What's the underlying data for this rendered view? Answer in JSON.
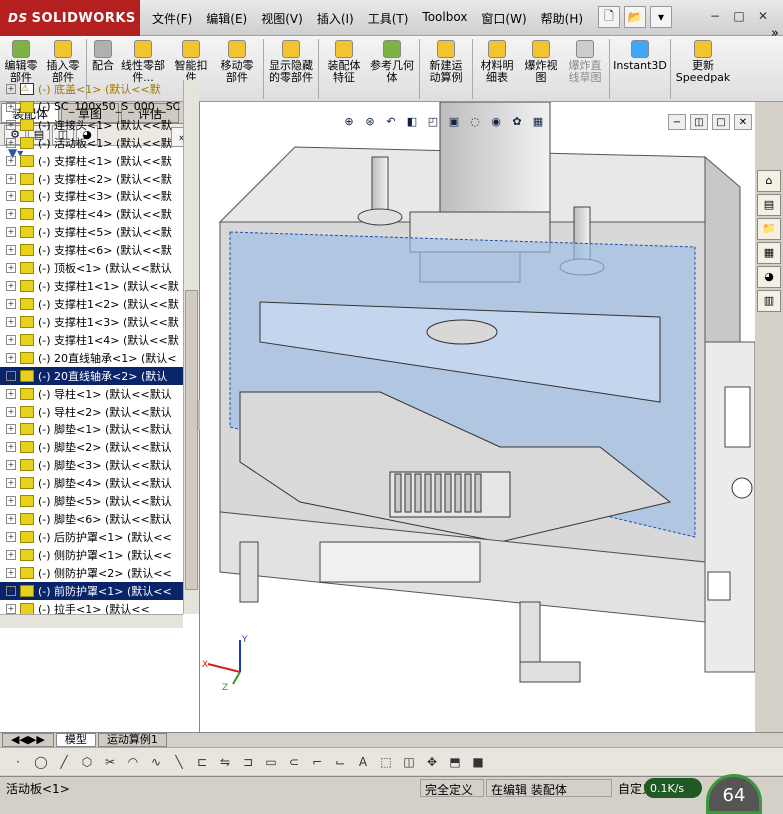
{
  "app": {
    "brand": "SOLIDWORKS",
    "brand_prefix": "DS"
  },
  "menu": [
    "文件(F)",
    "编辑(E)",
    "视图(V)",
    "插入(I)",
    "工具(T)",
    "Toolbox",
    "窗口(W)",
    "帮助(H)"
  ],
  "quick_tools": [
    "new-file-icon",
    "open-icon",
    "dropdown-icon"
  ],
  "window_controls": [
    "−",
    "□",
    "✕"
  ],
  "commands": [
    {
      "label": "编辑零部件",
      "icon": "edit-component-icon",
      "color": "#7cb342"
    },
    {
      "label": "插入零部件",
      "icon": "insert-component-icon",
      "color": "#f4c430"
    },
    {
      "label": "配合",
      "icon": "mate-icon",
      "color": "#b0b0b0"
    },
    {
      "label": "线性零部件...",
      "icon": "linear-pattern-icon",
      "color": "#f4c430"
    },
    {
      "label": "智能扣件",
      "icon": "smart-fastener-icon",
      "color": "#f4c430"
    },
    {
      "label": "移动零部件",
      "icon": "move-component-icon",
      "color": "#f4c430"
    },
    {
      "label": "显示隐藏的零部件",
      "icon": "show-hidden-icon",
      "color": "#f4c430"
    },
    {
      "label": "装配体特征",
      "icon": "assembly-feature-icon",
      "color": "#f4c430"
    },
    {
      "label": "参考几何体",
      "icon": "reference-geometry-icon",
      "color": "#7cb342"
    },
    {
      "label": "新建运动算例",
      "icon": "new-motion-study-icon",
      "color": "#f4c430"
    },
    {
      "label": "材料明细表",
      "icon": "bom-icon",
      "color": "#f4c430"
    },
    {
      "label": "爆炸视图",
      "icon": "exploded-view-icon",
      "color": "#f4c430"
    },
    {
      "label": "爆炸直线草图",
      "icon": "explode-line-sketch-icon",
      "color": "#cccccc",
      "disabled": true
    },
    {
      "label": "Instant3D",
      "icon": "instant3d-icon",
      "color": "#3fa9f5"
    },
    {
      "label": "更新Speedpak",
      "icon": "speedpak-icon",
      "color": "#f4c430"
    }
  ],
  "panel_tabs": [
    "装配体",
    "草图",
    "评估"
  ],
  "tree": [
    {
      "label": "(-) 底盖<1> (默认<<默",
      "warn": true
    },
    {
      "label": "(-) SC_100x50_S_000__SC"
    },
    {
      "label": "(-) 连接头<1> (默认<<默"
    },
    {
      "label": "(-) 活动板<1> (默认<<默"
    },
    {
      "label": "(-) 支撑柱<1> (默认<<默"
    },
    {
      "label": "(-) 支撑柱<2> (默认<<默"
    },
    {
      "label": "(-) 支撑柱<3> (默认<<默"
    },
    {
      "label": "(-) 支撑柱<4> (默认<<默"
    },
    {
      "label": "(-) 支撑柱<5> (默认<<默"
    },
    {
      "label": "(-) 支撑柱<6> (默认<<默"
    },
    {
      "label": "(-) 顶板<1> (默认<<默认"
    },
    {
      "label": "(-) 支撑柱1<1> (默认<<默"
    },
    {
      "label": "(-) 支撑柱1<2> (默认<<默"
    },
    {
      "label": "(-) 支撑柱1<3> (默认<<默"
    },
    {
      "label": "(-) 支撑柱1<4> (默认<<默"
    },
    {
      "label": "(-) 20直线轴承<1> (默认<"
    },
    {
      "label": "(-) 20直线轴承<2> (默认",
      "sel": true
    },
    {
      "label": "(-) 导柱<1> (默认<<默认"
    },
    {
      "label": "(-) 导柱<2> (默认<<默认"
    },
    {
      "label": "(-) 脚垫<1> (默认<<默认"
    },
    {
      "label": "(-) 脚垫<2> (默认<<默认"
    },
    {
      "label": "(-) 脚垫<3> (默认<<默认"
    },
    {
      "label": "(-) 脚垫<4> (默认<<默认"
    },
    {
      "label": "(-) 脚垫<5> (默认<<默认"
    },
    {
      "label": "(-) 脚垫<6> (默认<<默认"
    },
    {
      "label": "(-) 后防护罩<1> (默认<<"
    },
    {
      "label": "(-) 侧防护罩<1> (默认<<"
    },
    {
      "label": "(-) 侧防护罩<2> (默认<<"
    },
    {
      "label": "(-) 前防护罩<1> (默认<<",
      "sel": true
    },
    {
      "label": "(-) 拉手<1> (默认<<"
    }
  ],
  "bottom_tabs": [
    "模型",
    "运动算例1"
  ],
  "status": {
    "selection": "活动板<1>",
    "definition": "完全定义",
    "mode": "在编辑 装配体",
    "custom": "自定义",
    "speed": "0.1K/s",
    "gauge": "64"
  },
  "axis": {
    "x": "X",
    "y": "Y",
    "z": "Z"
  }
}
